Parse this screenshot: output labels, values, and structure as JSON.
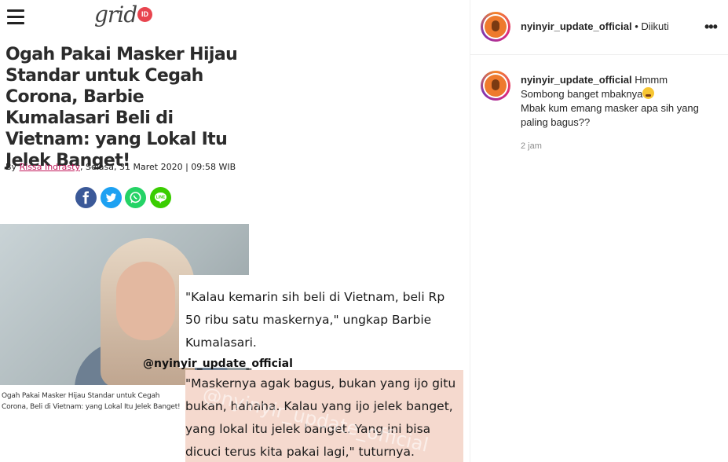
{
  "article": {
    "site_logo": "grid",
    "site_logo_badge": "ID",
    "headline": "Ogah Pakai Masker Hijau Standar untuk Cegah Corona, Barbie Kumalasari Beli di Vietnam: yang Lokal Itu Jelek Banget!",
    "byline_prefix": "By ",
    "author": "Rissa Indrasty",
    "byline_date": ", Selasa, 31 Maret 2020 | 09:58 WIB",
    "share_icons": [
      "facebook-icon",
      "twitter-icon",
      "whatsapp-icon",
      "line-icon"
    ],
    "share_colors": [
      "#3b5998",
      "#1da1f2",
      "#25d366",
      "#3acd01"
    ],
    "photo_caption": "Ogah Pakai Masker Hijau Standar untuk Cegah Corona, Beli di Vietnam: yang Lokal Itu Jelek Banget!",
    "quote1": "\"Kalau kemarin sih beli di Vietnam, beli Rp 50 ribu satu maskernya,\" ungkap Barbie Kumalasari.",
    "quote2": "\"Maskernya agak bagus, bukan yang ijo gitu bukan, hahaha. Kalau yang ijo jelek banget, yang lokal itu jelek banget. Yang ini bisa dicuci terus kita pakai lagi,\" tuturnya.",
    "watermark": "@nyinyir_update_official",
    "highlight_color": "#f5d9ce"
  },
  "sidebar": {
    "username": "nyinyir_update_official",
    "follow_status": "• Diikuti",
    "more_icon": "more-horizontal-icon",
    "comment": {
      "username": "nyinyir_update_official",
      "text1": " Hmmm Sombong banget mbaknya",
      "emoji": "tired-face-emoji",
      "text2": "Mbak kum emang masker apa sih yang paling bagus??",
      "time": "2 jam"
    }
  }
}
